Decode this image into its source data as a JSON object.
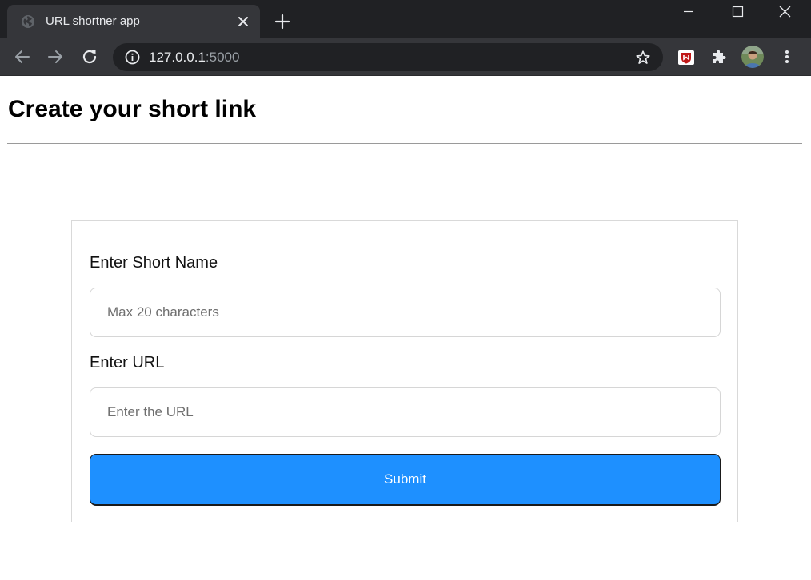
{
  "browser": {
    "tab": {
      "title": "URL shortner app",
      "favicon": "globe-icon"
    },
    "window_controls": [
      "minimize-icon",
      "maximize-icon",
      "close-icon"
    ],
    "address_bar": {
      "host": "127.0.0.1",
      "port": ":5000"
    },
    "extensions": [
      "mcafee-icon",
      "puzzle-icon"
    ],
    "colors": {
      "frame": "#202124",
      "toolbar": "#35363a",
      "text": "#e8eaed"
    }
  },
  "page": {
    "title": "Create your short link",
    "form": {
      "short_name_label": "Enter Short Name",
      "short_name_placeholder": "Max 20 characters",
      "short_name_value": "",
      "url_label": "Enter URL",
      "url_placeholder": "Enter the URL",
      "url_value": "",
      "submit_label": "Submit"
    },
    "colors": {
      "accent": "#1e90ff"
    }
  }
}
